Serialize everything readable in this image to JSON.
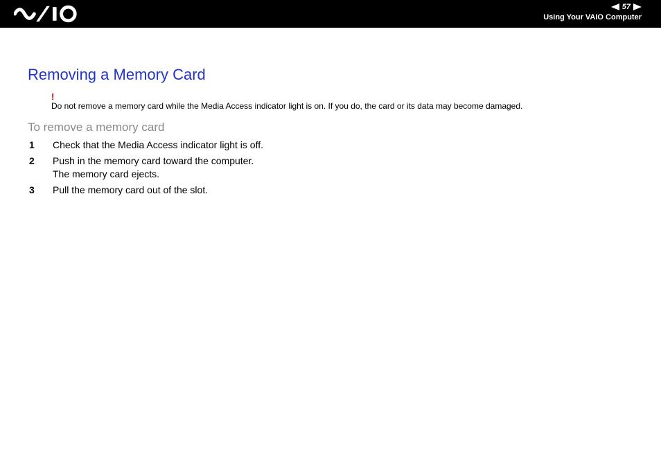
{
  "header": {
    "page_number": "57",
    "section": "Using Your VAIO Computer"
  },
  "content": {
    "title": "Removing a Memory Card",
    "warning": {
      "mark": "!",
      "text_before": "Do not remove a memory card while the ",
      "text_media": "Media Access",
      "text_after": " indicator light is on. If you do, the card or its data may become damaged."
    },
    "subheading": "To remove a memory card",
    "steps": [
      {
        "num": "1",
        "line1": "Check that the Media Access indicator light is off.",
        "line2": ""
      },
      {
        "num": "2",
        "line1": "Push in the memory card toward the computer.",
        "line2": "The memory card ejects."
      },
      {
        "num": "3",
        "line1": "Pull the memory card out of the slot.",
        "line2": ""
      }
    ]
  }
}
